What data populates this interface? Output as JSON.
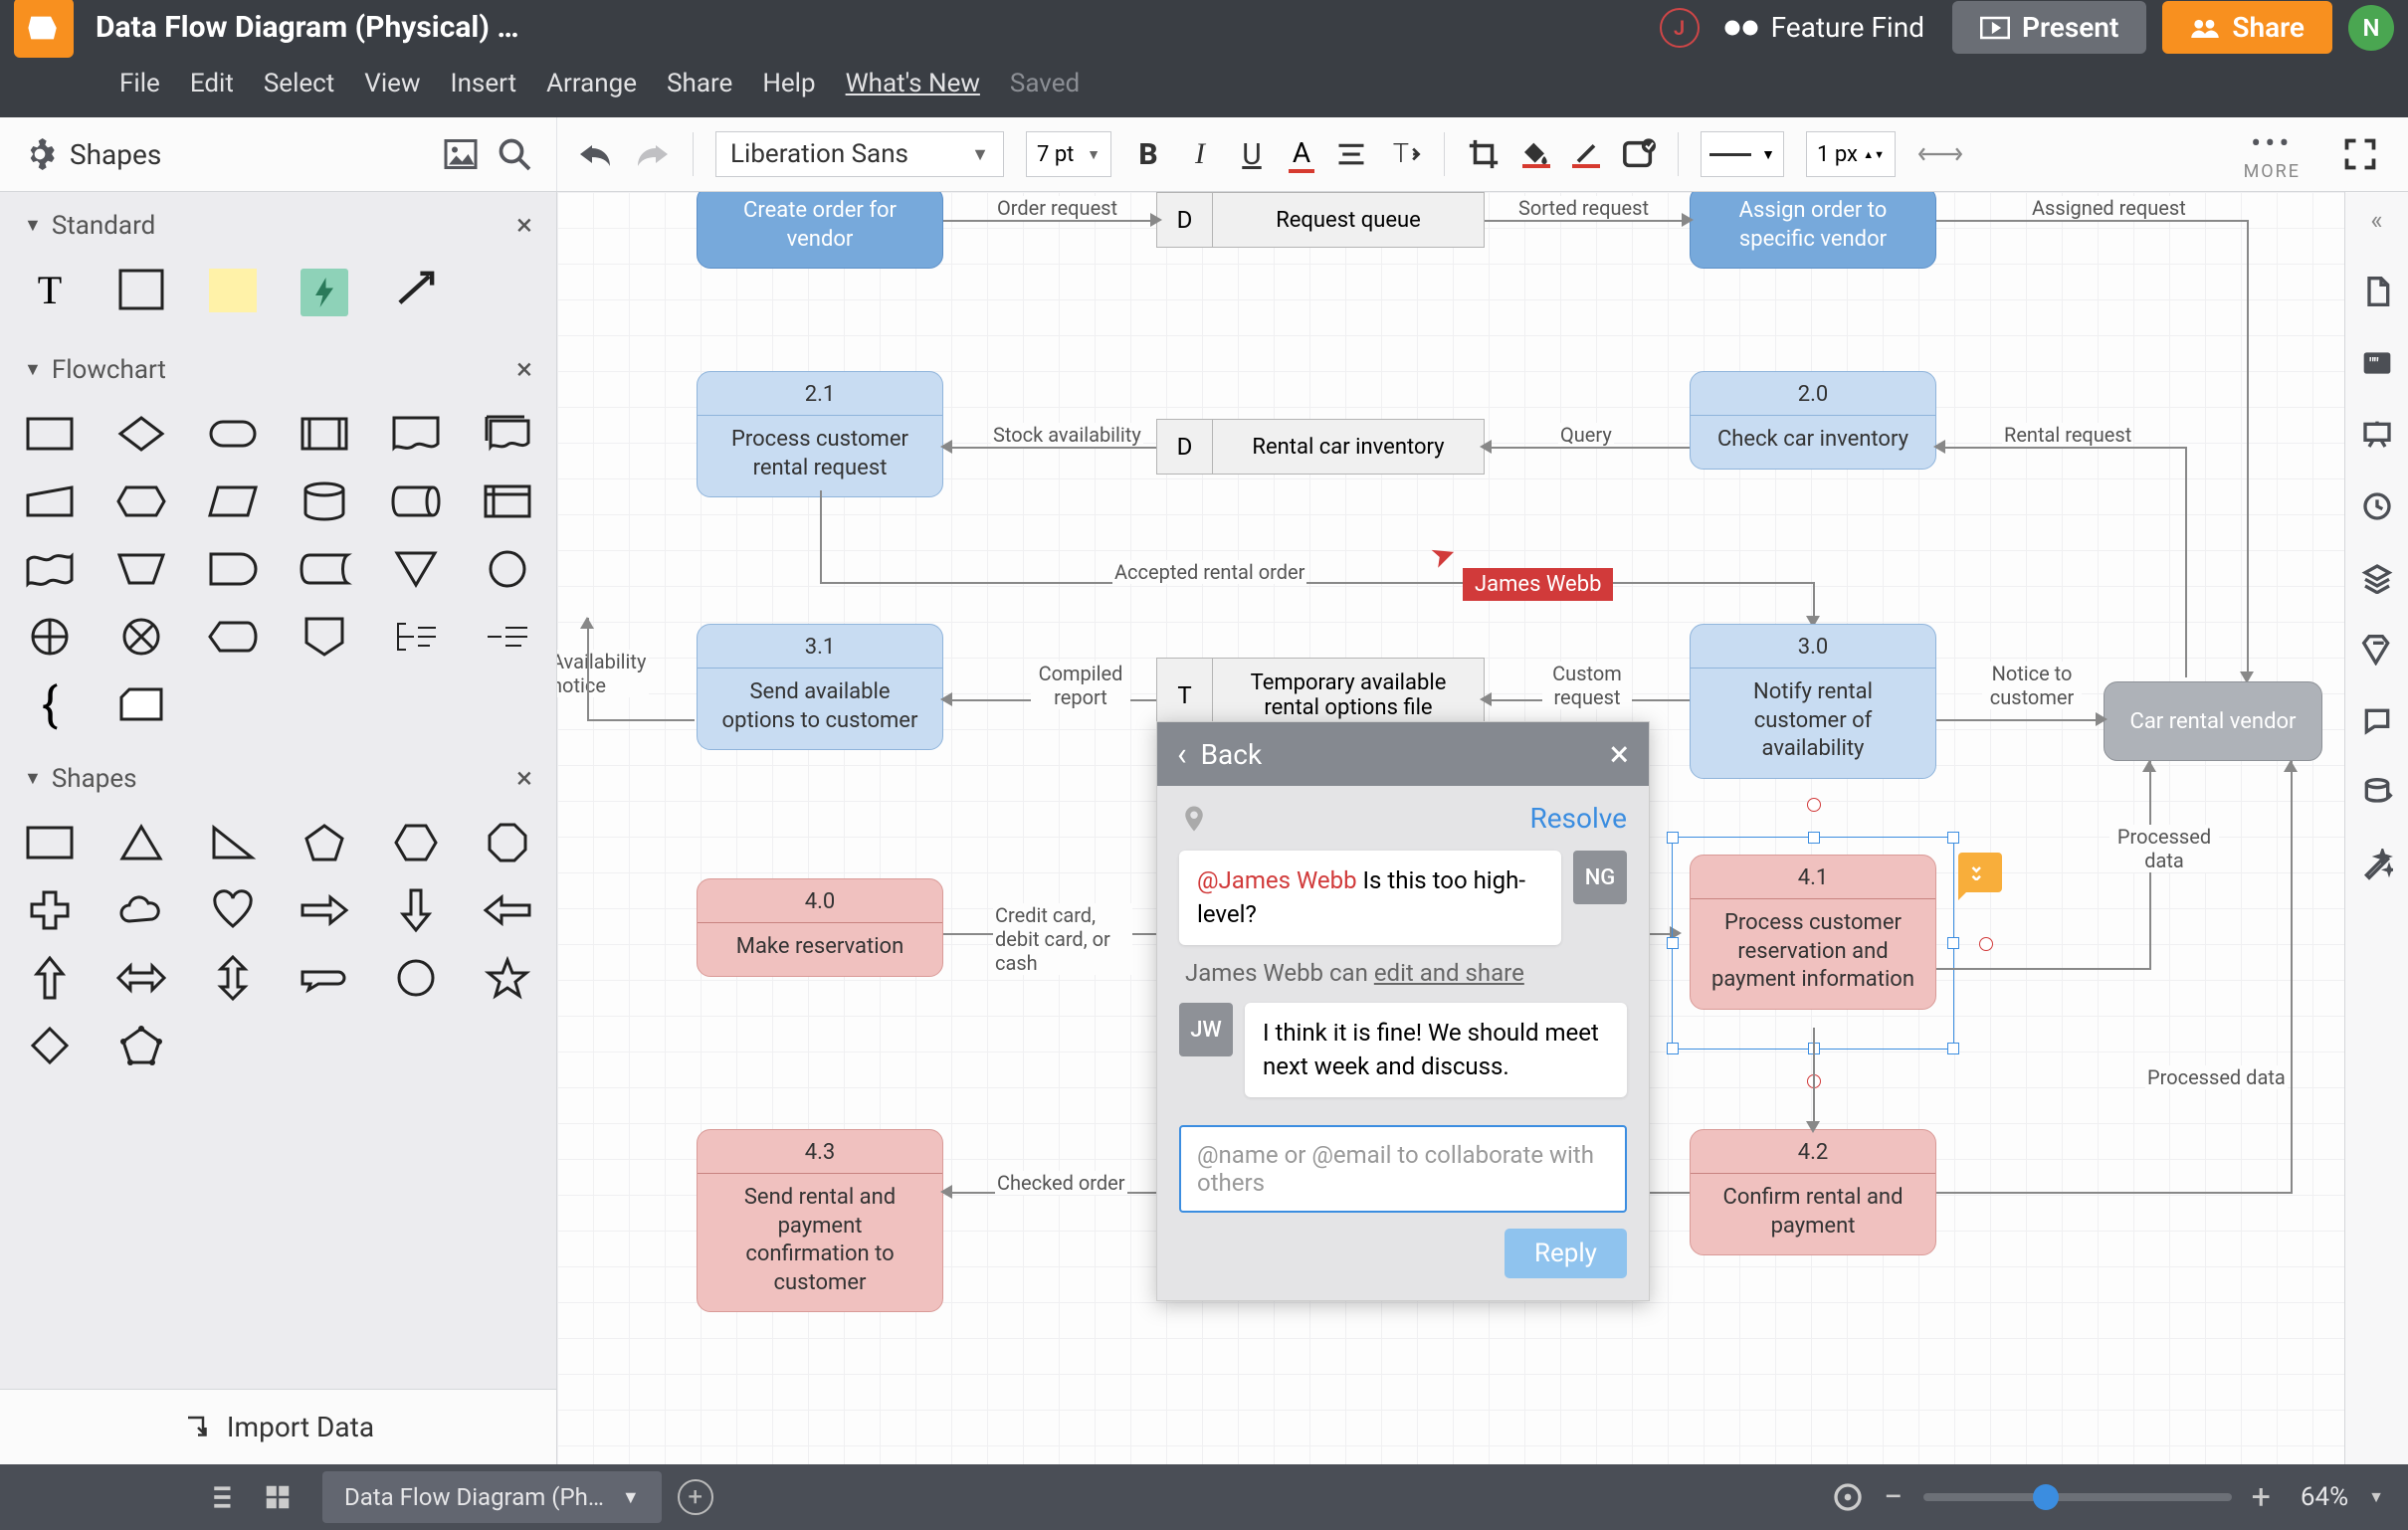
{
  "header": {
    "title": "Data Flow Diagram (Physical) …",
    "menus": [
      "File",
      "Edit",
      "Select",
      "View",
      "Insert",
      "Arrange",
      "Share",
      "Help",
      "What's New"
    ],
    "saved": "Saved",
    "avatar_j": "J",
    "feature_find": "Feature Find",
    "present": "Present",
    "share": "Share",
    "avatar_n": "N"
  },
  "toolbar": {
    "shapes": "Shapes",
    "font": "Liberation Sans",
    "size": "7 pt",
    "line_width": "1 px",
    "more": "MORE"
  },
  "left_panel": {
    "sections": [
      "Standard",
      "Flowchart",
      "Shapes"
    ],
    "import": "Import Data"
  },
  "canvas": {
    "cursor_user": "James Webb",
    "nodes": {
      "n0a": "Create order for vendor",
      "ds0": {
        "l": "D",
        "r": "Request queue"
      },
      "n0b_id": "",
      "n0b": "Assign order to specific vendor",
      "n21_id": "2.1",
      "n21": "Process customer rental request",
      "ds1": {
        "l": "D",
        "r": "Rental car inventory"
      },
      "n20_id": "2.0",
      "n20": "Check car inventory",
      "n31_id": "3.1",
      "n31": "Send available options to customer",
      "ds2": {
        "l": "T",
        "r": "Temporary available rental options file"
      },
      "n30_id": "3.0",
      "n30": "Notify rental customer of availability",
      "n40_id": "4.0",
      "n40": "Make reservation",
      "n41_id": "4.1",
      "n41": "Process customer reservation and payment information",
      "n43_id": "4.3",
      "n43": "Send rental and payment confirmation to customer",
      "n42_id": "4.2",
      "n42": "Confirm rental and payment",
      "vendor": "Car rental vendor"
    },
    "edges": {
      "e1": "Order request",
      "e2": "Sorted request",
      "e3": "Assigned request",
      "e4": "Stock availability",
      "e5": "Query",
      "e6": "Rental request",
      "e7": "Availability notice",
      "e8": "Compiled report",
      "e9": "Accepted rental order",
      "e10": "Custom request",
      "e11": "Notice to customer",
      "e12": "Credit card, debit card, or cash",
      "e13": "Processed data",
      "e14": "Checked order",
      "e15": "Processed data"
    }
  },
  "comments": {
    "back": "Back",
    "resolve": "Resolve",
    "c1_avatar": "NG",
    "c1_mention": "@James Webb",
    "c1_text": " Is this too high-level?",
    "perm_user": "James Webb",
    "perm_text": " can ",
    "perm_link": "edit and share",
    "c2_avatar": "JW",
    "c2_text": "I think it is fine! We should meet next week and discuss.",
    "input_placeholder": "@name or @email to collaborate with others",
    "reply": "Reply"
  },
  "bottom": {
    "page_tab": "Data Flow Diagram (Ph…",
    "zoom": "64%"
  }
}
